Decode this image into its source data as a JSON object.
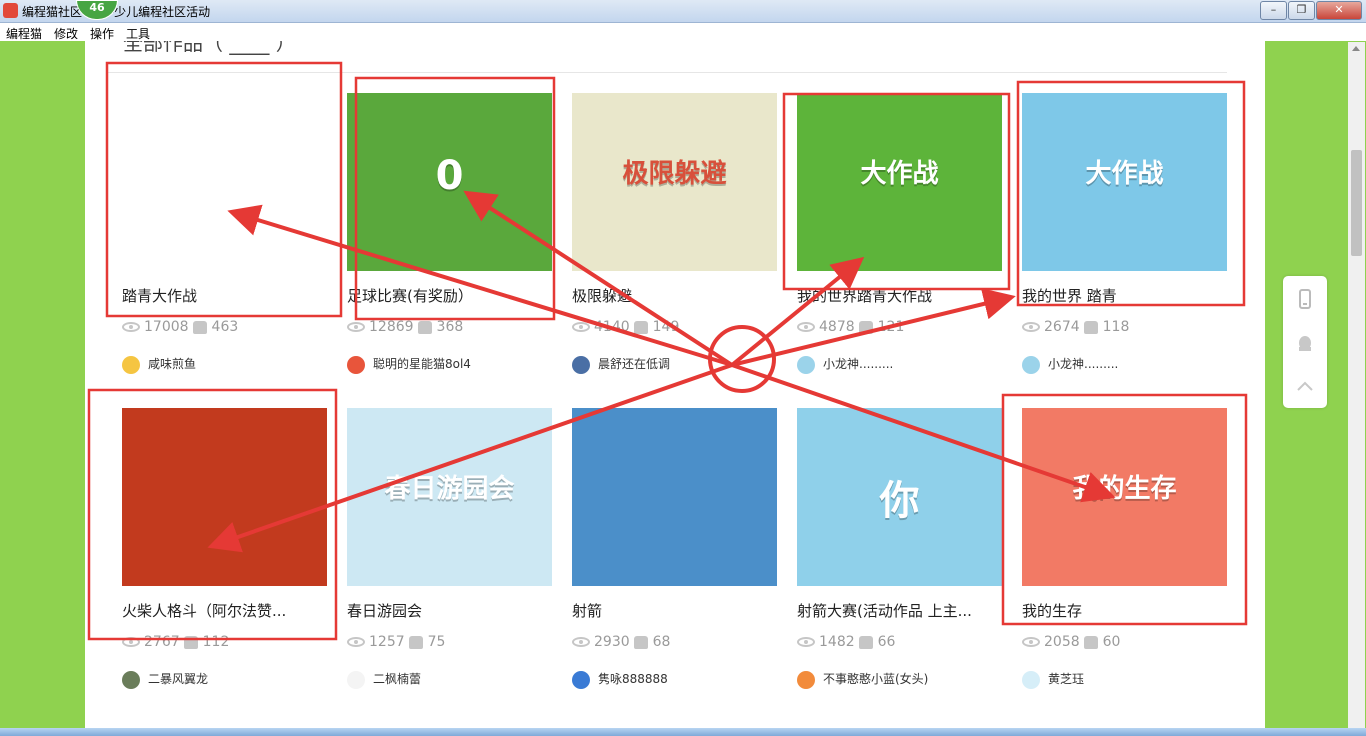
{
  "window": {
    "title": "编程猫社区 活动-少儿编程社区活动",
    "badge": "46",
    "buttons": {
      "minimize": "–",
      "maximize": "❐",
      "close": "✕"
    }
  },
  "menu": [
    "编程猫",
    "修改",
    "操作",
    "工具"
  ],
  "section": {
    "heading": "全部作品（ ____ ）"
  },
  "cards": [
    {
      "title": "踏青大作战",
      "views": "17008",
      "likes": "463",
      "author": "咸味煎鱼",
      "thumb_bg": "#ffffff",
      "thumb_text": ""
    },
    {
      "title": "足球比赛(有奖励）",
      "views": "12869",
      "likes": "368",
      "author": "聪明的星能猫8ol4",
      "thumb_bg": "#5aa83c",
      "thumb_text": "0"
    },
    {
      "title": "极限躲避",
      "views": "4140",
      "likes": "149",
      "author": "晨舒还在低调",
      "thumb_bg": "#e9e7cb",
      "thumb_text": "极限躲避"
    },
    {
      "title": "我的世界踏青大作战",
      "views": "4878",
      "likes": "121",
      "author": "小龙神.........",
      "thumb_bg": "#5db43a",
      "thumb_text": "大作战"
    },
    {
      "title": "我的世界 踏青",
      "views": "2674",
      "likes": "118",
      "author": "小龙神.........",
      "thumb_bg": "#7ec8e8",
      "thumb_text": "大作战"
    },
    {
      "title": "火柴人格斗（阿尔法赞...",
      "views": "2767",
      "likes": "112",
      "author": "二暴风翼龙",
      "thumb_bg": "#c23a1e",
      "thumb_text": ""
    },
    {
      "title": "春日游园会",
      "views": "1257",
      "likes": "75",
      "author": "二枫楠蕾",
      "thumb_bg": "#cde8f3",
      "thumb_text": "春日游园会"
    },
    {
      "title": "射箭",
      "views": "2930",
      "likes": "68",
      "author": "隽咏888888",
      "thumb_bg": "#4b8fc9",
      "thumb_text": ""
    },
    {
      "title": "射箭大赛(活动作品 上主...",
      "views": "1482",
      "likes": "66",
      "author": "不事憨憨小蓝(女头)",
      "thumb_bg": "#8fd0ea",
      "thumb_text": "你"
    },
    {
      "title": "我的生存",
      "views": "2058",
      "likes": "60",
      "author": "黄芝珏",
      "thumb_bg": "#f27a65",
      "thumb_text": "我的生存"
    }
  ],
  "colors": {
    "page_bg": "#8fd24f",
    "annotation": "#e53935",
    "accent_green": "#47a543"
  }
}
